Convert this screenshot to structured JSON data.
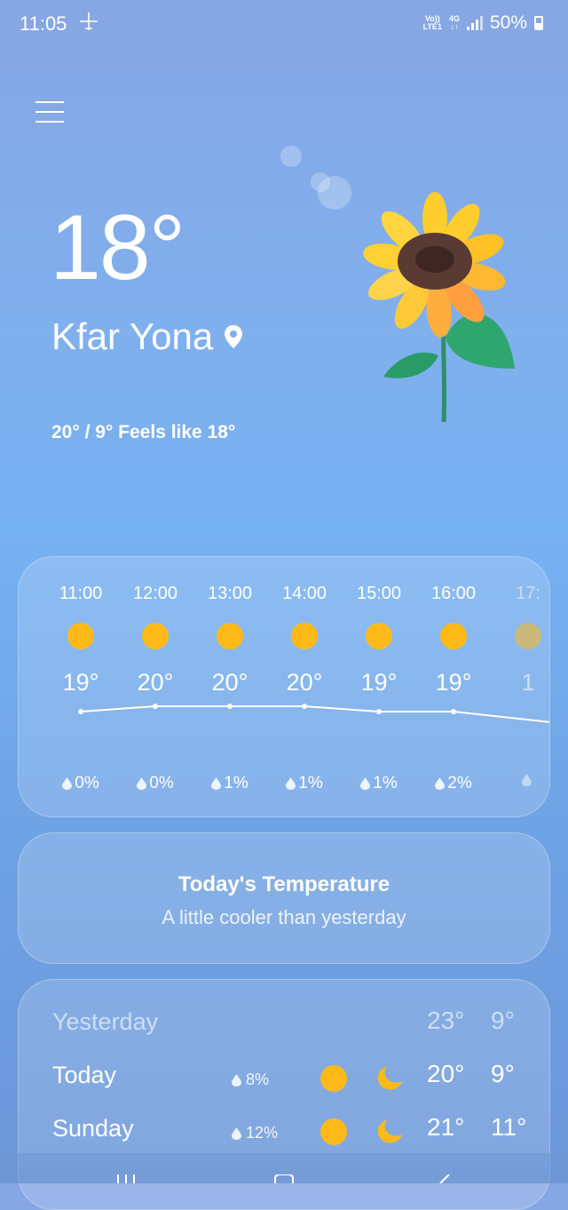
{
  "status_bar": {
    "time": "11:05",
    "volte": "Vo))",
    "lte": "LTE1",
    "network": "4G",
    "battery": "50%"
  },
  "current": {
    "temperature": "18°",
    "location": "Kfar Yona",
    "hilo_feels": "20° / 9° Feels like 18°"
  },
  "hourly": [
    {
      "time": "11:00",
      "temp": "19°",
      "precip": "0%"
    },
    {
      "time": "12:00",
      "temp": "20°",
      "precip": "0%"
    },
    {
      "time": "13:00",
      "temp": "20°",
      "precip": "1%"
    },
    {
      "time": "14:00",
      "temp": "20°",
      "precip": "1%"
    },
    {
      "time": "15:00",
      "temp": "19°",
      "precip": "1%"
    },
    {
      "time": "16:00",
      "temp": "19°",
      "precip": "2%"
    },
    {
      "time": "17:",
      "temp": "1",
      "precip": ""
    }
  ],
  "today_card": {
    "title": "Today's Temperature",
    "subtitle": "A little cooler than yesterday"
  },
  "daily": [
    {
      "day": "Yesterday",
      "precip": "",
      "high": "23°",
      "low": "9°"
    },
    {
      "day": "Today",
      "precip": "8%",
      "high": "20°",
      "low": "9°"
    },
    {
      "day": "Sunday",
      "precip": "12%",
      "high": "21°",
      "low": "11°"
    }
  ],
  "colors": {
    "sun": "#ffba1a",
    "background_top": "#86a6e3",
    "background_mid": "#76b1f1"
  }
}
